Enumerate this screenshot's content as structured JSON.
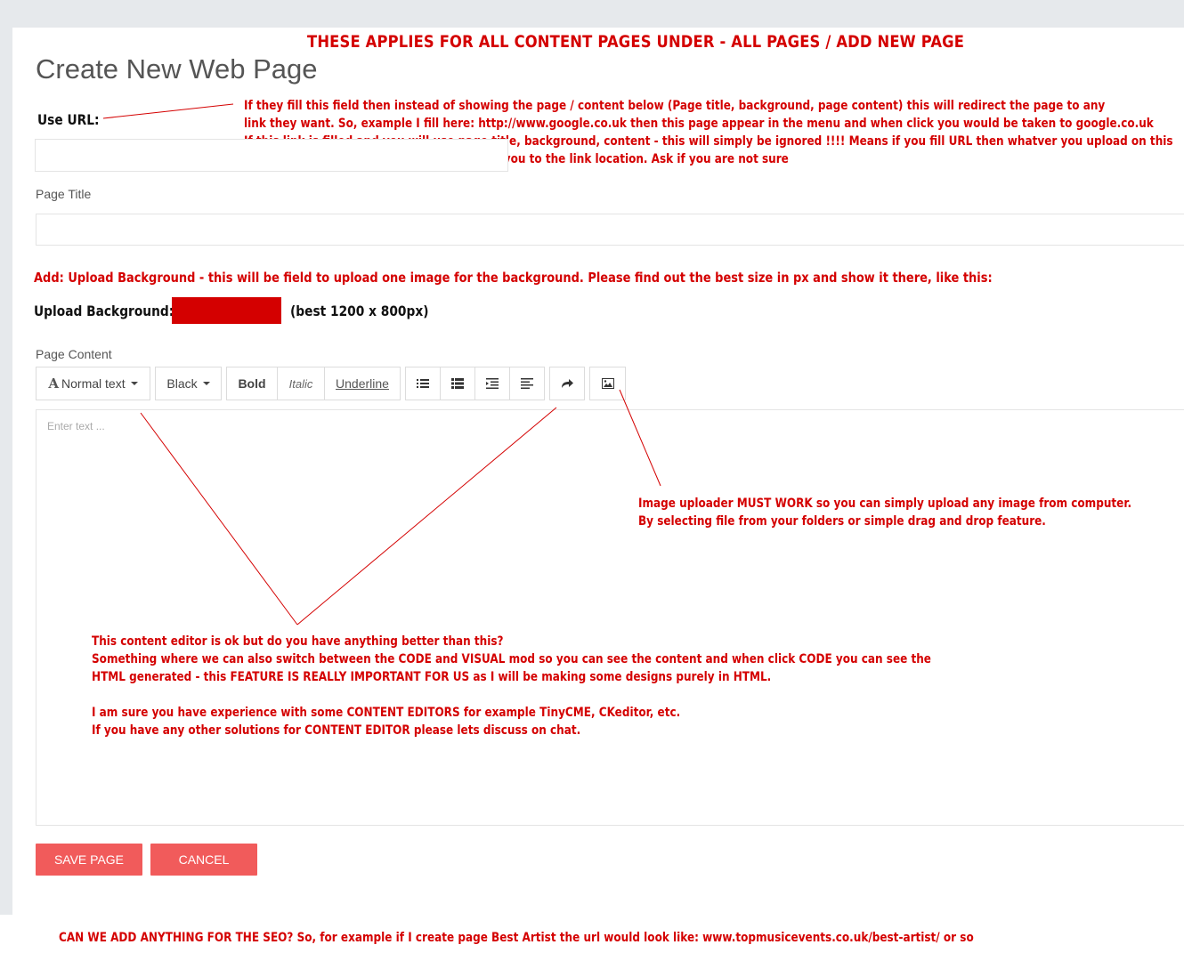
{
  "annotations": {
    "heading": "THESE APPLIES FOR ALL CONTENT PAGES UNDER - ALL PAGES / ADD NEW PAGE",
    "url_note": [
      "If they fill this field then instead of showing the page / content below (Page title, background, page content) this will redirect the page to any",
      "link they want. So, example I fill here: http://www.google.co.uk    then this page appear in the menu and when click you would be taken to google.co.uk",
      "If this link is filled and you will use page title, background, content - this will simply be ignored !!!!  Means if you fill URL then whatver you upload on this",
      "page it DOES NOT MATTER, as it will takes you to the link location. Ask if you are not sure"
    ],
    "add_note": "Add:   Upload Background - this will be field to upload one image for the background. Please find out the best size in px and show it there, like this:",
    "image_note": [
      "Image uploader MUST WORK so you can simply upload any image from computer.",
      "By selecting file from your folders or simple drag and drop feature."
    ],
    "editor_note": [
      "This content editor is ok but do you have anything better than this?",
      "Something where we can also switch between the CODE and VISUAL mod so you can see the content and when click CODE you can see the",
      "HTML generated - this FEATURE IS REALLY IMPORTANT FOR US as I will be making some designs purely in HTML.",
      "",
      "I am sure you have experience with some CONTENT EDITORS for example  TinyCME, CKeditor, etc.",
      "If you have any other solutions for CONTENT EDITOR please lets discuss on chat."
    ],
    "seo_note": "CAN WE ADD ANYTHING FOR THE SEO? So, for example if I create page  Best Artist the url would look like:   www.topmusicevents.co.uk/best-artist/ or so",
    "color": "#d40000"
  },
  "form": {
    "page_title": "Create New Web Page",
    "use_url_label": "Use URL:",
    "use_url_value": "",
    "page_title_label": "Page Title",
    "page_title_value": "",
    "upload_background_label": "Upload Background:",
    "upload_background_hint": "(best 1200 x 800px)",
    "page_content_label": "Page Content",
    "editor_placeholder": "Enter text ..."
  },
  "toolbar": {
    "text_style": "Normal text",
    "color": "Black",
    "bold": "Bold",
    "italic": "Italic",
    "underline": "Underline",
    "icons": [
      "unordered-list-icon",
      "ordered-list-icon",
      "outdent-icon",
      "indent-icon",
      "redo-icon",
      "image-icon"
    ]
  },
  "buttons": {
    "save": "SAVE PAGE",
    "cancel": "CANCEL",
    "accent": "#f15b5b"
  }
}
